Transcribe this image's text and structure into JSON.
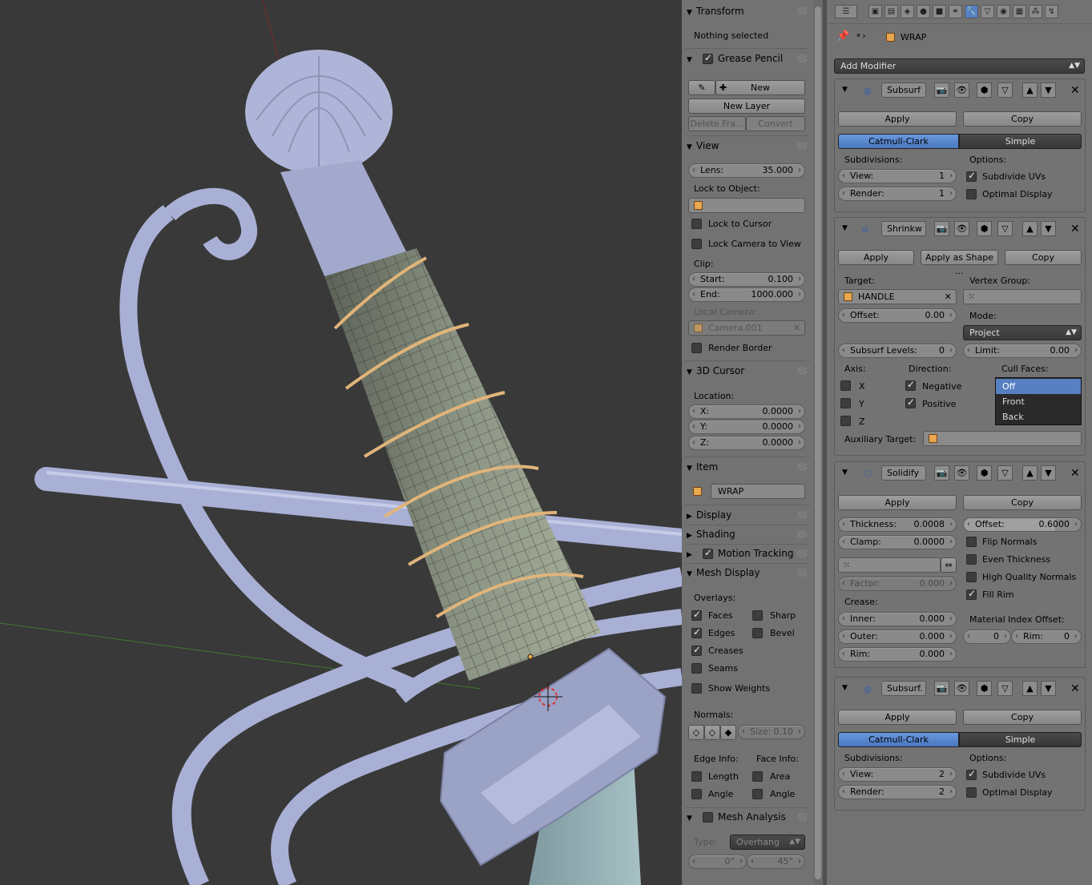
{
  "npanel": {
    "transform": {
      "title": "Transform",
      "status": "Nothing selected"
    },
    "grease_pencil": {
      "title": "Grease Pencil",
      "new_label": "New",
      "new_layer_label": "New Layer",
      "delete_frame_label": "Delete Fra...",
      "convert_label": "Convert"
    },
    "view": {
      "title": "View",
      "lens_label": "Lens:",
      "lens_value": "35.000",
      "lock_to_object_label": "Lock to Object:",
      "lock_to_cursor_label": "Lock to Cursor",
      "lock_camera_label": "Lock Camera to View",
      "clip_label": "Clip:",
      "start_label": "Start:",
      "start_value": "0.100",
      "end_label": "End:",
      "end_value": "1000.000",
      "local_camera_label": "Local Camera:",
      "local_camera_value": "Camera.001",
      "render_border_label": "Render Border"
    },
    "cursor": {
      "title": "3D Cursor",
      "location_label": "Location:",
      "x_label": "X:",
      "x_value": "0.0000",
      "y_label": "Y:",
      "y_value": "0.0000",
      "z_label": "Z:",
      "z_value": "0.0000"
    },
    "item": {
      "title": "Item",
      "name": "WRAP"
    },
    "display": {
      "title": "Display"
    },
    "shading": {
      "title": "Shading"
    },
    "motion_tracking": {
      "title": "Motion Tracking"
    },
    "mesh_display": {
      "title": "Mesh Display",
      "overlays_label": "Overlays:",
      "faces": "Faces",
      "sharp": "Sharp",
      "edges": "Edges",
      "bevel": "Bevel",
      "creases": "Creases",
      "seams": "Seams",
      "show_weights": "Show Weights",
      "normals_label": "Normals:",
      "size_label": "Size:",
      "size_value": "0.10",
      "edge_info_label": "Edge Info:",
      "face_info_label": "Face Info:",
      "length": "Length",
      "area": "Area",
      "angle1": "Angle",
      "angle2": "Angle"
    },
    "mesh_analysis": {
      "title": "Mesh Analysis",
      "type_label": "Type:",
      "type_value": "Overhang",
      "min_value": "0°",
      "max_value": "45°"
    }
  },
  "props": {
    "breadcrumb_object": "WRAP",
    "add_modifier_label": "Add Modifier",
    "subsurf1": {
      "name": "Subsurf",
      "apply_label": "Apply",
      "copy_label": "Copy",
      "catmull_label": "Catmull-Clark",
      "simple_label": "Simple",
      "subdivisions_label": "Subdivisions:",
      "options_label": "Options:",
      "view_label": "View:",
      "view_value": "1",
      "render_label": "Render:",
      "render_value": "1",
      "subdivide_uvs_label": "Subdivide UVs",
      "optimal_display_label": "Optimal Display"
    },
    "shrinkwrap": {
      "name": "Shrinkw",
      "apply_label": "Apply",
      "apply_shape_label": "Apply as Shape ...",
      "copy_label": "Copy",
      "target_label": "Target:",
      "target_value": "HANDLE",
      "vertex_group_label": "Vertex Group:",
      "offset_label": "Offset:",
      "offset_value": "0.00",
      "mode_label": "Mode:",
      "mode_value": "Project",
      "subsurf_levels_label": "Subsurf Levels:",
      "subsurf_levels_value": "0",
      "limit_label": "Limit:",
      "limit_value": "0.00",
      "axis_label": "Axis:",
      "axis_x": "X",
      "axis_y": "Y",
      "axis_z": "Z",
      "direction_label": "Direction:",
      "negative_label": "Negative",
      "positive_label": "Positive",
      "cull_faces_label": "Cull Faces:",
      "cull_options": [
        "Off",
        "Front",
        "Back"
      ],
      "auxiliary_target_label": "Auxiliary Target:"
    },
    "solidify": {
      "name": "Solidify",
      "apply_label": "Apply",
      "copy_label": "Copy",
      "thickness_label": "Thickness:",
      "thickness_value": "0.0008",
      "offset_label": "Offset:",
      "offset_value": "0.6000",
      "clamp_label": "Clamp:",
      "clamp_value": "0.0000",
      "flip_normals_label": "Flip Normals",
      "even_thickness_label": "Even Thickness",
      "high_quality_normals_label": "High Quality Normals",
      "fill_rim_label": "Fill Rim",
      "factor_label": "Factor:",
      "factor_value": "0.000",
      "crease_label": "Crease:",
      "inner_label": "Inner:",
      "inner_value": "0.000",
      "outer_label": "Outer:",
      "outer_value": "0.000",
      "rim_label": "Rim:",
      "rim_value": "0.000",
      "material_index_offset_label": "Material Index Offset:",
      "mat_offset_value": "0",
      "mat_rim_label": "Rim:",
      "mat_rim_value": "0"
    },
    "subsurf2": {
      "name": "Subsurf.",
      "apply_label": "Apply",
      "copy_label": "Copy",
      "catmull_label": "Catmull-Clark",
      "simple_label": "Simple",
      "subdivisions_label": "Subdivisions:",
      "options_label": "Options:",
      "view_label": "View:",
      "view_value": "2",
      "render_label": "Render:",
      "render_value": "2",
      "subdivide_uvs_label": "Subdivide UVs",
      "optimal_display_label": "Optimal Display"
    }
  },
  "colors": {
    "accent": "#5680c2",
    "viewport_bg": "#393939",
    "panel_bg": "#727272",
    "model": "#a9b0d6"
  }
}
